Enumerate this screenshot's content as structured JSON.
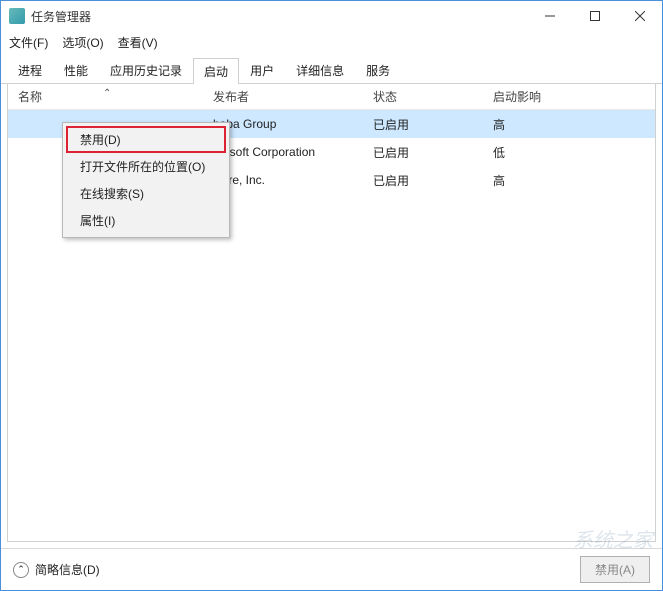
{
  "window": {
    "title": "任务管理器"
  },
  "menubar": {
    "file": "文件(F)",
    "options": "选项(O)",
    "view": "查看(V)"
  },
  "tabs": {
    "processes": "进程",
    "performance": "性能",
    "app_history": "应用历史记录",
    "startup": "启动",
    "users": "用户",
    "details": "详细信息",
    "services": "服务"
  },
  "columns": {
    "name": "名称",
    "publisher": "发布者",
    "status": "状态",
    "impact": "启动影响"
  },
  "rows": [
    {
      "name": "",
      "publisher": "baba Group",
      "status": "已启用",
      "impact": "高"
    },
    {
      "name": "",
      "publisher": "crosoft Corporation",
      "status": "已启用",
      "impact": "低"
    },
    {
      "name": "",
      "publisher": "ware, Inc.",
      "status": "已启用",
      "impact": "高"
    }
  ],
  "context_menu": {
    "disable": "禁用(D)",
    "open_location": "打开文件所在的位置(O)",
    "search_online": "在线搜索(S)",
    "properties": "属性(I)"
  },
  "footer": {
    "fewer_details": "简略信息(D)",
    "disable_button": "禁用(A)"
  }
}
